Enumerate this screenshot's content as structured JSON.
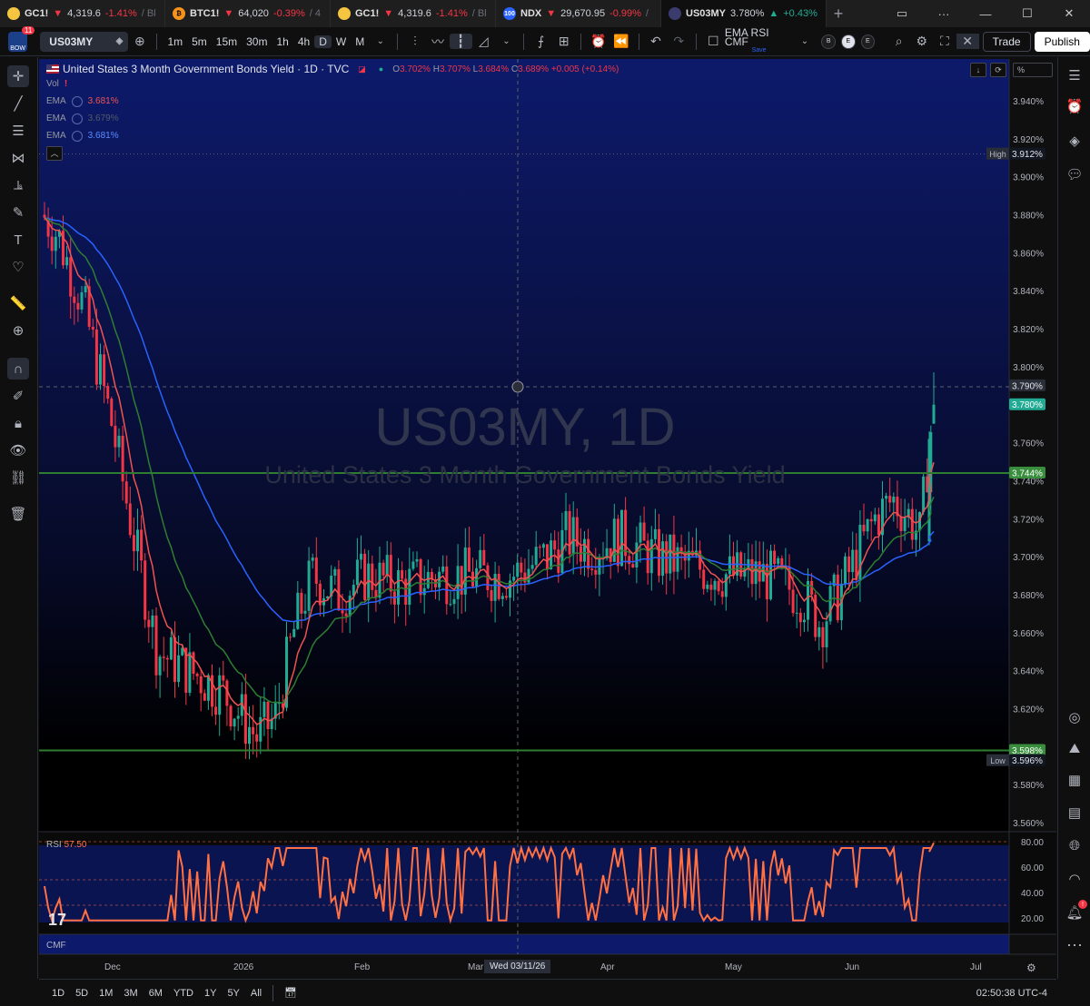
{
  "tabs": [
    {
      "symbol": "GC1!",
      "price": "4,319.6",
      "change": "-1.41%",
      "tail": "/ Bl",
      "dir": "neg",
      "icon_color": "#f5c542",
      "icon": "gold-coin-icon",
      "active": false
    },
    {
      "symbol": "BTC1!",
      "price": "64,020",
      "change": "-0.39%",
      "tail": "/ 4",
      "dir": "neg",
      "icon_color": "#f7931a",
      "icon": "bitcoin-icon",
      "active": false
    },
    {
      "symbol": "GC1!",
      "price": "4,319.6",
      "change": "-1.41%",
      "tail": "/ Bl",
      "dir": "neg",
      "icon_color": "#f5c542",
      "icon": "gold-coin-icon",
      "active": false
    },
    {
      "symbol": "NDX",
      "price": "29,670.95",
      "change": "-0.99%",
      "tail": "/",
      "dir": "neg",
      "icon_color": "#2962ff",
      "icon": "nasdaq-100-icon",
      "active": false
    },
    {
      "symbol": "US03MY",
      "price": "3.780%",
      "change": "+0.43%",
      "tail": "/",
      "dir": "pos",
      "icon_color": "#3c3b6e",
      "icon": "us-flag-icon",
      "active": true
    }
  ],
  "toolbar": {
    "avatar_text": "BOW",
    "notification_count": "11",
    "symbol": "US03MY",
    "intervals": [
      "1m",
      "5m",
      "15m",
      "30m",
      "1h",
      "4h",
      "D",
      "W",
      "M"
    ],
    "selected_interval": "D",
    "indicator_template": "EMA RSI CMF",
    "indicator_template_sub": "Save",
    "circle_buttons": [
      "B",
      "E",
      "E"
    ],
    "trade_label": "Trade",
    "publish_label": "Publish"
  },
  "legend": {
    "title": "United States 3 Month Government Bonds Yield · 1D · TVC",
    "open_label": "O",
    "open": "3.702%",
    "high_label": "H",
    "high": "3.707%",
    "low_label": "L",
    "low": "3.684%",
    "close_label": "C",
    "close": "3.689%",
    "change": "+0.005 (+0.14%)",
    "vol_label": "Vol",
    "emas": [
      {
        "label": "EMA",
        "value": "3.681%",
        "color": "#ef5350"
      },
      {
        "label": "EMA",
        "value": "3.679%",
        "color": "#388e3c"
      },
      {
        "label": "EMA",
        "value": "3.681%",
        "color": "#2962ff"
      }
    ]
  },
  "watermark": {
    "symbol": "US03MY, 1D",
    "description": "United States 3 Month Government Bonds Yield"
  },
  "price_axis": {
    "ticks": [
      "3.940%",
      "3.920%",
      "3.900%",
      "3.880%",
      "3.860%",
      "3.840%",
      "3.820%",
      "3.800%",
      "3.780%",
      "3.760%",
      "3.740%",
      "3.720%",
      "3.700%",
      "3.680%",
      "3.660%",
      "3.640%",
      "3.620%",
      "3.600%",
      "3.580%",
      "3.560%"
    ],
    "high_tag": "High",
    "high_value": "3.912%",
    "low_tag": "Low",
    "low_value": "3.596%",
    "crosshair_value": "3.790%",
    "last_price": "3.780%",
    "level_upper": "3.744%",
    "level_lower": "3.598%",
    "percent_button": "%"
  },
  "rsi": {
    "label": "RSI",
    "value": "57.50",
    "ticks": [
      "80.00",
      "60.00",
      "40.00",
      "20.00"
    ]
  },
  "cmf": {
    "label": "CMF"
  },
  "time_axis": {
    "labels": [
      "Dec",
      "2026",
      "Feb",
      "Mar",
      "Apr",
      "May",
      "Jun",
      "Jul"
    ],
    "crosshair_date": "Wed 03/11/26"
  },
  "ranges": [
    "1D",
    "5D",
    "1M",
    "3M",
    "6M",
    "YTD",
    "1Y",
    "5Y",
    "All"
  ],
  "clock": "02:50:38 UTC-4",
  "colors": {
    "up": "#22ab94",
    "down": "#f23645",
    "ema_fast": "#ef5350",
    "ema_mid": "#2e7d32",
    "ema_slow": "#2962ff",
    "rsi": "#ff7043",
    "level": "#2e7d32"
  },
  "chart_data": {
    "type": "candlestick",
    "symbol": "US03MY",
    "interval": "1D",
    "ylim": [
      3.55,
      3.95
    ],
    "horizontal_levels": [
      3.744,
      3.598
    ],
    "high": 3.912,
    "low": 3.596,
    "last": 3.78,
    "rsi_last": 57.5
  }
}
